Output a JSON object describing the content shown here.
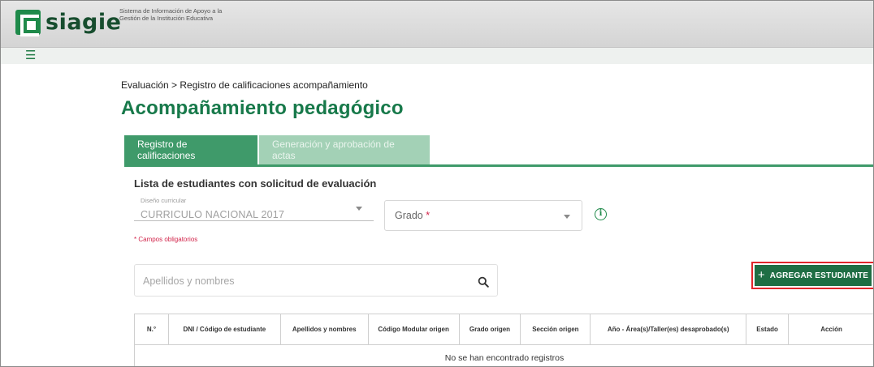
{
  "header": {
    "logo_text": "siagie",
    "system_description": "Sistema de Información de Apoyo a la Gestión de la Institución Educativa"
  },
  "breadcrumb": "Evaluación > Registro de calificaciones acompañamiento",
  "page_title": "Acompañamiento pedagógico",
  "tabs": [
    {
      "label": "Registro de calificaciones",
      "active": true
    },
    {
      "label": "Generación y aprobación de actas",
      "active": false
    }
  ],
  "section_title": "Lista de estudiantes con solicitud de evaluación",
  "filters": {
    "design": {
      "label": "Diseño curricular",
      "value": "CURRICULO NACIONAL 2017"
    },
    "grado": {
      "label": "Grado",
      "required_mark": "*"
    }
  },
  "required_note": "* Campos obligatorios",
  "search": {
    "placeholder": "Apellidos y nombres"
  },
  "add_button": {
    "label": "AGREGAR ESTUDIANTE"
  },
  "table": {
    "columns": [
      "N.°",
      "DNI / Código de estudiante",
      "Apellidos y nombres",
      "Código Modular origen",
      "Grado origen",
      "Sección origen",
      "Año - Área(s)/Taller(es) desaprobado(s)",
      "Estado",
      "Acción"
    ],
    "empty_message": "No se han encontrado registros"
  },
  "colors": {
    "brand_green": "#1f8a4a",
    "title_green": "#17794a",
    "tab_active": "#3f9a6a",
    "tab_inactive": "#a3d1b6",
    "button_green": "#1f6e44",
    "required_red": "#d2254b",
    "highlight_red": "#e2262c"
  },
  "icons": [
    "siagie-logo-icon",
    "menu-icon",
    "chevron-down-icon",
    "info-icon",
    "search-icon",
    "plus-icon"
  ]
}
